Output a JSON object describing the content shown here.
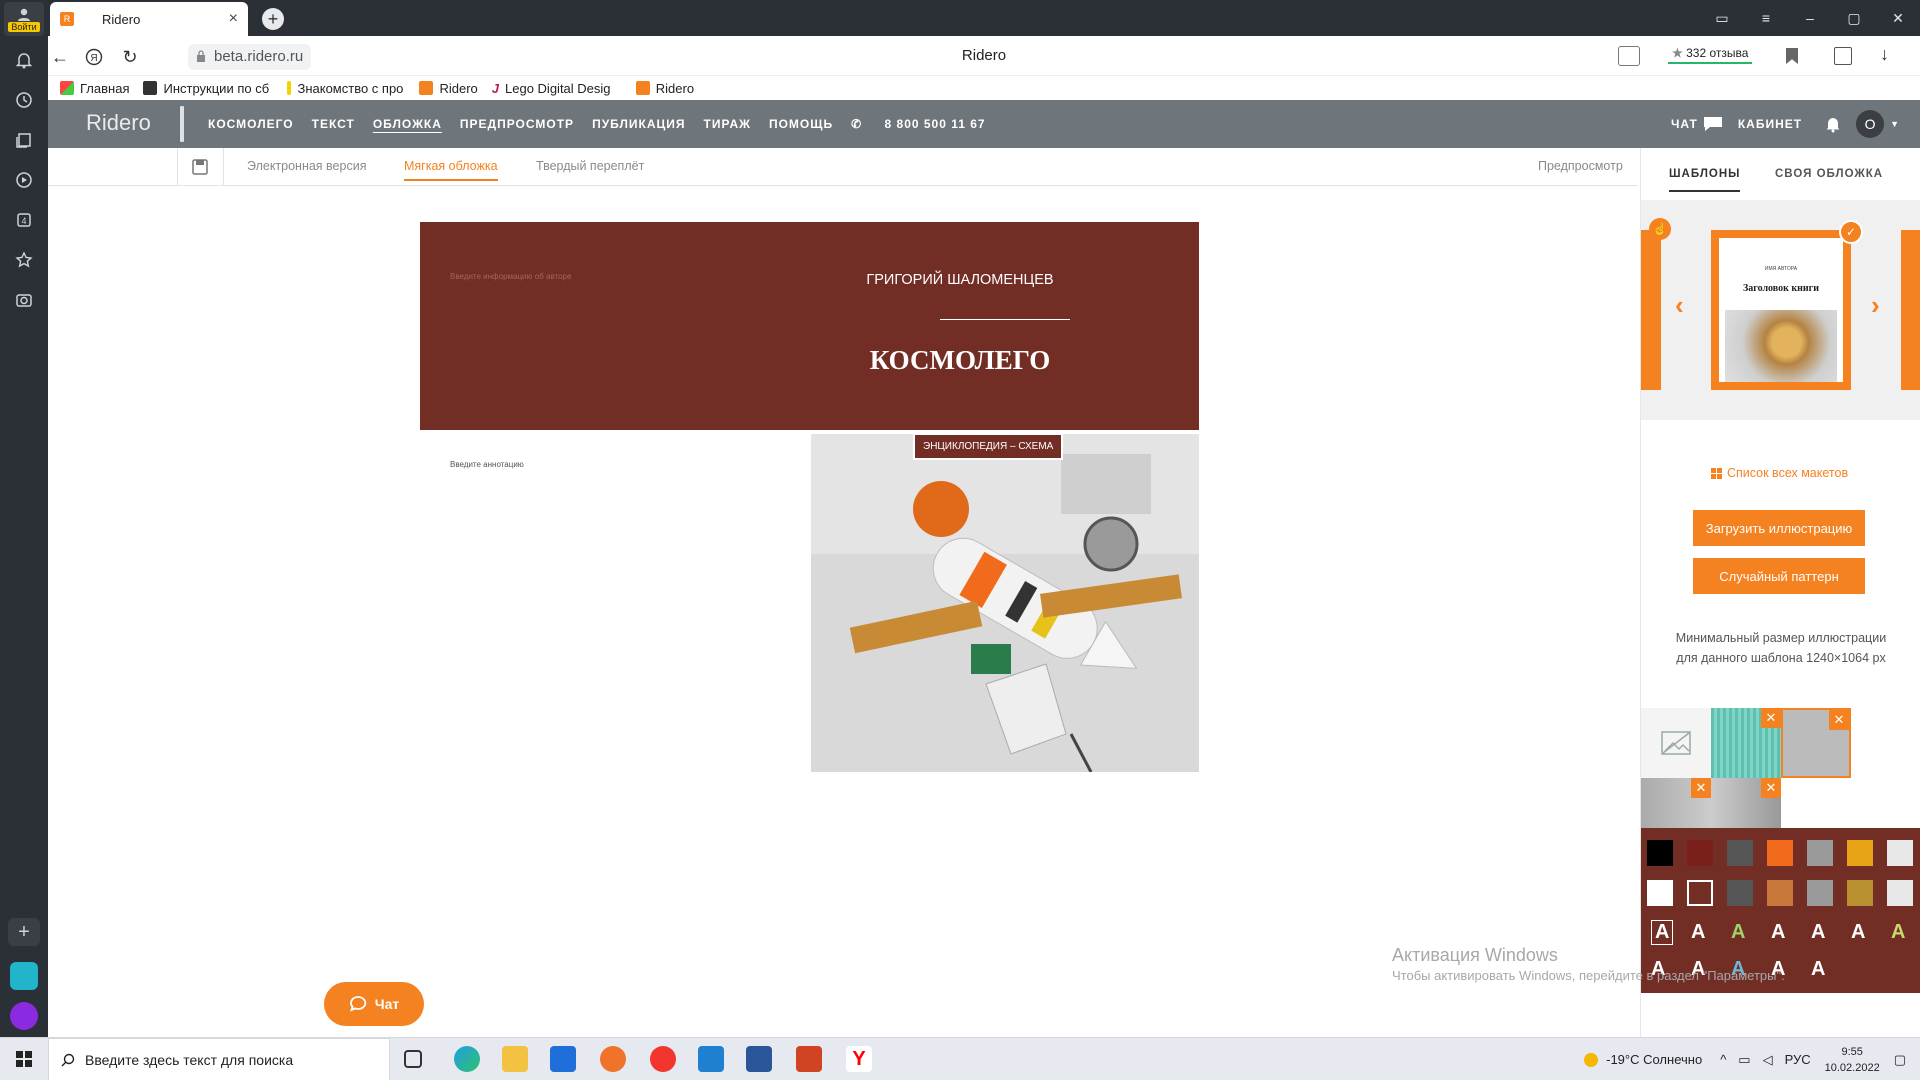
{
  "sidebar": {
    "login_label": "Войти",
    "icons": [
      "bell-icon",
      "history-icon",
      "collections-icon",
      "video-icon",
      "tabs-icon",
      "star-icon",
      "screenshot-icon"
    ]
  },
  "browser": {
    "tab_title": "Ridero",
    "url": "beta.ridero.ru",
    "page_title": "Ridero",
    "reviews": "332 отзыва",
    "bookmarks": [
      "Главная",
      "Инструкции по сб",
      "Знакомство с про",
      "Ridero",
      "Lego Digital Desig",
      "Ridero"
    ]
  },
  "site": {
    "logo": "Ridero",
    "nav": [
      "КОСМОЛЕГО",
      "ТЕКСТ",
      "ОБЛОЖКА",
      "ПРЕДПРОСМОТР",
      "ПУБЛИКАЦИЯ",
      "ТИРАЖ",
      "ПОМОЩЬ"
    ],
    "phone": "8 800 500 11 67",
    "chat": "ЧАТ",
    "cabinet": "КАБИНЕТ",
    "avatar": "О"
  },
  "editor": {
    "tabs": [
      "Электронная версия",
      "Мягкая обложка",
      "Твердый переплёт"
    ],
    "active_tab": "Мягкая обложка",
    "preview": "Предпросмотр"
  },
  "cover": {
    "author_placeholder": "Введите информацию об авторе",
    "author": "ГРИГОРИЙ ШАЛОМЕНЦЕВ",
    "title": "КОСМОЛЕГО",
    "annotation_placeholder": "Введите аннотацию",
    "subtitle": "ЭНЦИКЛОПЕДИЯ – СХЕМА",
    "color": "#722e25"
  },
  "panel": {
    "tabs": [
      "ШАБЛОНЫ",
      "СВОЯ ОБЛОЖКА"
    ],
    "template_author": "ИМЯ АВТОРА",
    "template_title": "Заголовок книги",
    "all_layouts": "Список всех макетов",
    "upload_btn": "Загрузить иллюстрацию",
    "random_btn": "Случайный паттерн",
    "min_size_line1": "Минимальный размер иллюстрации",
    "min_size_line2": "для данного шаблона 1240×1064 px",
    "swatches_row1": [
      "#000000",
      "#7b1f1a",
      "#555555",
      "#f26a1b",
      "#9a9a9a",
      "#e8a317",
      "#e8e8e8"
    ],
    "swatches_row2": [
      "#ffffff",
      "#722e25",
      "#555555",
      "#c9773a",
      "#9a9a9a",
      "#b8902f",
      "#e8e8e8"
    ],
    "font_letters": [
      "A",
      "A",
      "A",
      "A",
      "A",
      "A",
      "A",
      "A",
      "A",
      "A",
      "A",
      "A"
    ],
    "font_colors": [
      "#ffffff",
      "#ffffff",
      "#9fd36a",
      "#ffffff",
      "#ffffff",
      "#ffffff",
      "#c8d86a",
      "#ffffff",
      "#ffffff",
      "#6fb6d8",
      "#ffffff",
      "#ffffff"
    ]
  },
  "chat_button": "Чат",
  "activation": {
    "title": "Активация Windows",
    "text": "Чтобы активировать Windows, перейдите в раздел \"Параметры\"."
  },
  "taskbar": {
    "search_placeholder": "Введите здесь текст для поиска",
    "weather": "-19°C  Солнечно",
    "lang": "РУС",
    "time": "9:55",
    "date": "10.02.2022"
  }
}
